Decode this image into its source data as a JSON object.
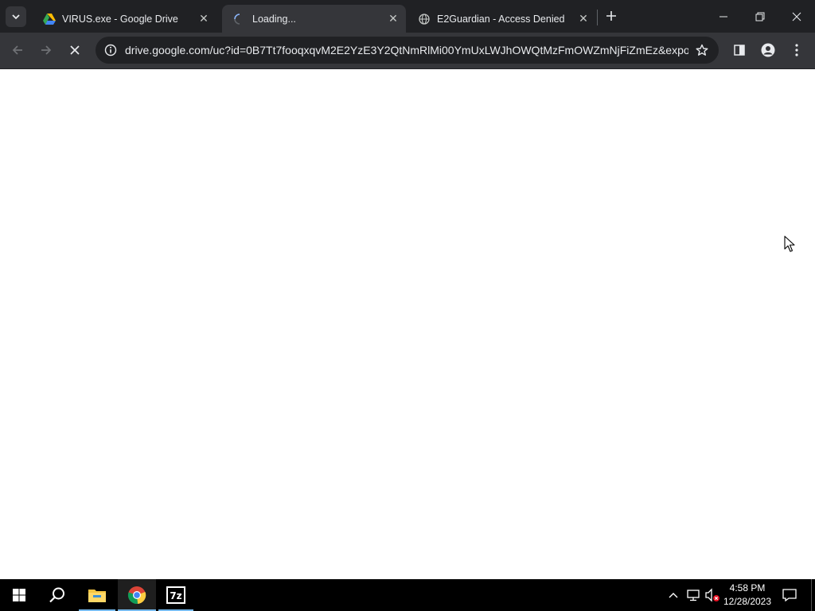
{
  "tabs": [
    {
      "title": "VIRUS.exe - Google Drive",
      "favicon": "google-drive-icon",
      "active": false
    },
    {
      "title": "Loading...",
      "favicon": "loading-spinner-icon",
      "active": true
    },
    {
      "title": "E2Guardian - Access Denied",
      "favicon": "globe-icon",
      "active": false
    }
  ],
  "toolbar": {
    "url": "drive.google.com/uc?id=0B7Tt7fooqxqvM2E2YzE3Y2QtNmRlMi00YmUxLWJhOWQtMzFmOWZmNjFiZmEz&expor..."
  },
  "taskbar": {
    "time": "4:58 PM",
    "date": "12/28/2023",
    "apps": [
      "file-explorer",
      "google-chrome",
      "7-zip"
    ]
  },
  "colors": {
    "titlebar": "#202124",
    "toolbar": "#35363a",
    "omnibox": "#202124",
    "taskbar": "#000000",
    "accent": "#76b9ed"
  }
}
